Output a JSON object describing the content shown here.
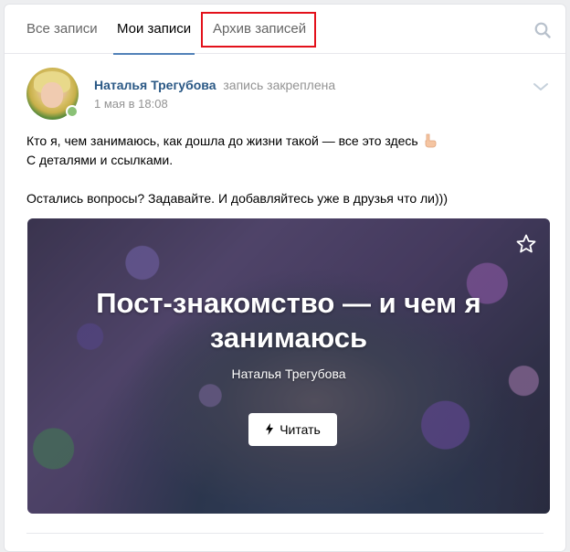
{
  "tabs": {
    "all": "Все записи",
    "mine": "Мои записи",
    "archive": "Архив записей"
  },
  "post": {
    "author": "Наталья Трегубова",
    "action": "запись закреплена",
    "date": "1 мая в 18:08",
    "text": {
      "line1": "Кто я, чем занимаюсь, как дошла до жизни такой — все это здесь",
      "line2": "С деталями и ссылками.",
      "line3": "Остались вопросы? Задавайте. И добавляйтесь уже в друзья что ли)))"
    },
    "article": {
      "title": "Пост-знакомство — и чем я занимаюсь",
      "author": "Наталья Трегубова",
      "read_label": "Читать"
    }
  },
  "colors": {
    "link": "#2a5885",
    "accent": "#5181b8",
    "highlight": "#e3111b",
    "online": "#8ac176"
  },
  "icons": [
    "search-icon",
    "chevron-down-icon",
    "pointing-hand-icon",
    "star-icon",
    "bolt-icon"
  ]
}
